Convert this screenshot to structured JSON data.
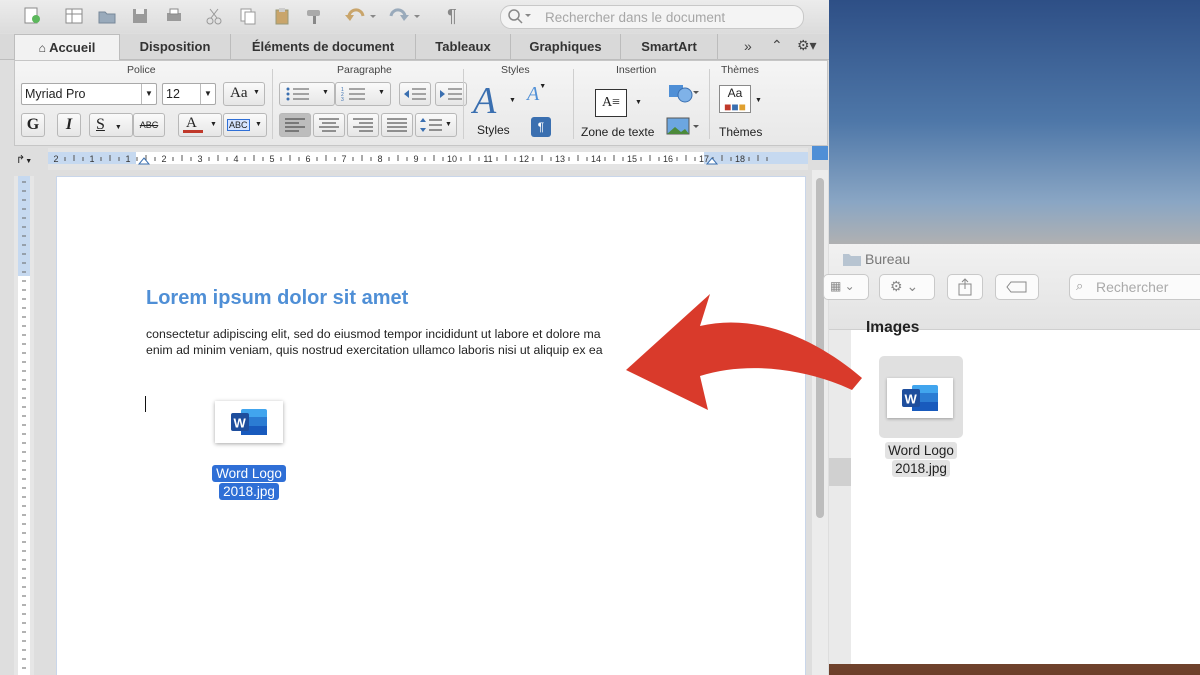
{
  "qat": {
    "search_placeholder": "Rechercher dans le document"
  },
  "tabs": [
    "Accueil",
    "Disposition",
    "Éléments de document",
    "Tableaux",
    "Graphiques",
    "SmartArt"
  ],
  "ribbon": {
    "groups": [
      "Police",
      "Paragraphe",
      "Styles",
      "Insertion",
      "Thèmes"
    ],
    "font_name": "Myriad Pro",
    "font_size": "12",
    "styles_label": "Styles",
    "textbox_label": "Zone de texte",
    "themes_label": "Thèmes",
    "font_color": "#c0392b",
    "highlight_color": "#2f6fd6"
  },
  "ruler_numbers": [
    "2",
    "1",
    "1",
    "2",
    "3",
    "4",
    "5",
    "6",
    "7",
    "8",
    "9",
    "10",
    "11",
    "12",
    "13",
    "14",
    "15",
    "16",
    "17",
    "18"
  ],
  "document": {
    "heading": "Lorem ipsum dolor sit amet",
    "heading_color": "#4f8fd6",
    "line1": "consectetur adipiscing elit, sed do eiusmod tempor incididunt ut labore et dolore ma",
    "line2": "enim ad minim veniam, quis nostrud exercitation ullamco laboris nisi ut aliquip ex ea",
    "dragged_file": {
      "name_line1": "Word Logo",
      "name_line2": "2018.jpg",
      "selection_color": "#2f6fd6"
    }
  },
  "finder": {
    "title": "Bureau",
    "search_placeholder": "Rechercher",
    "section": "Images",
    "file": {
      "name_line1": "Word Logo",
      "name_line2": "2018.jpg"
    }
  },
  "arrow": {
    "color": "#d93a2b"
  }
}
